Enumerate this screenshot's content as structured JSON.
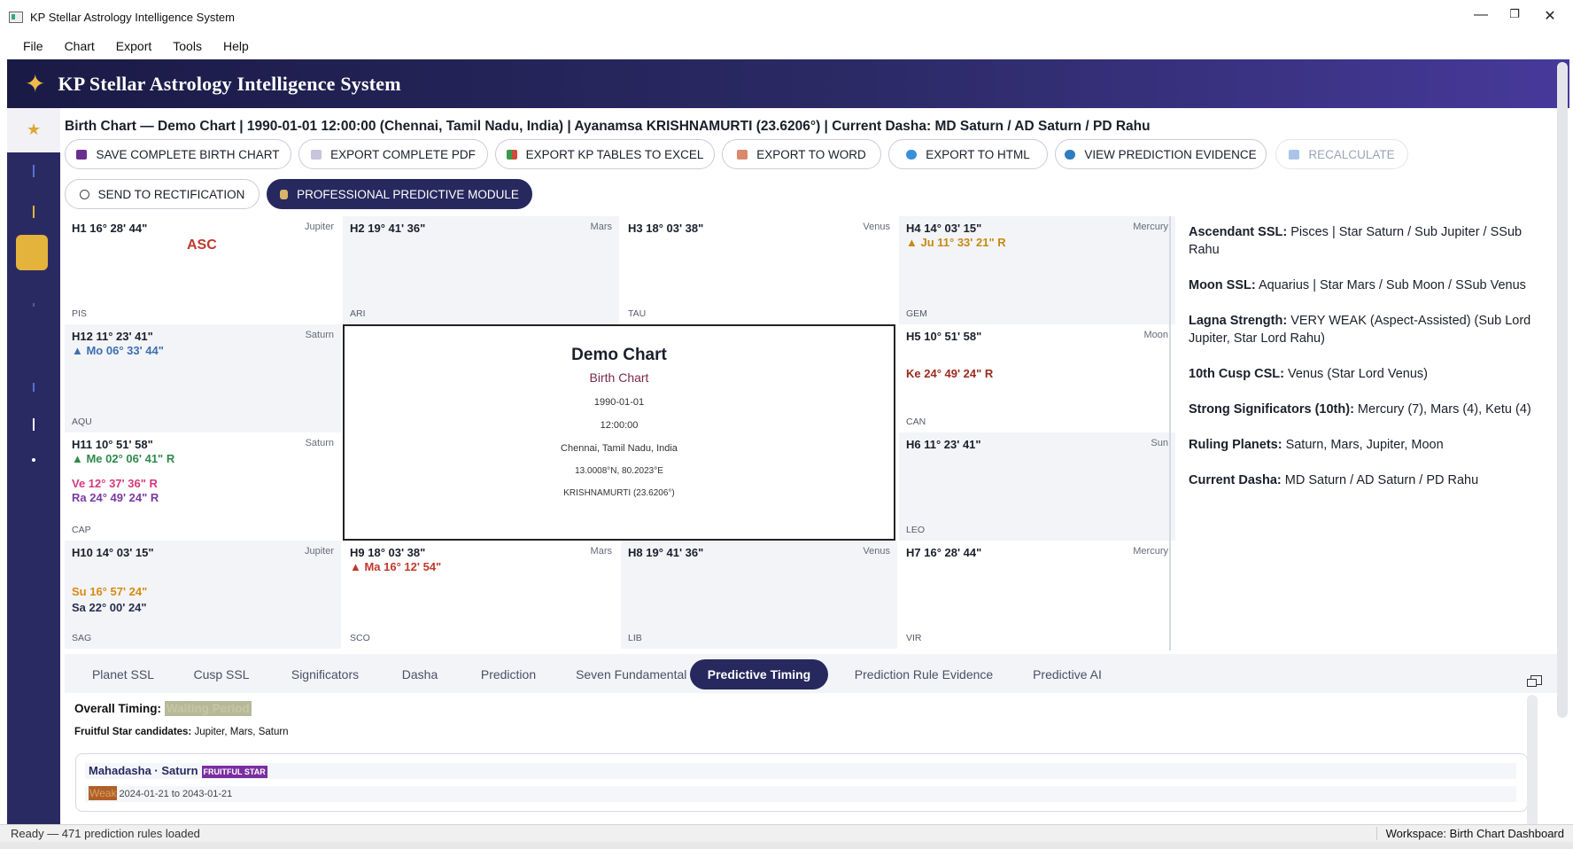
{
  "window": {
    "title": "KP Stellar Astrology Intelligence System",
    "min": "—",
    "max": "❐",
    "close": "✕"
  },
  "menu": [
    "File",
    "Chart",
    "Export",
    "Tools",
    "Help"
  ],
  "banner": {
    "title": "KP Stellar Astrology Intelligence System"
  },
  "info_line": "Birth Chart — Demo Chart  |  1990-01-01 12:00:00 (Chennai, Tamil Nadu, India)  |  Ayanamsa KRISHNAMURTI (23.6206°)  |  Current Dasha: MD Saturn / AD Saturn / PD Rahu",
  "buttons": {
    "save": "SAVE COMPLETE BIRTH CHART",
    "pdf": "EXPORT COMPLETE PDF",
    "excel": "EXPORT KP TABLES TO EXCEL",
    "word": "EXPORT TO WORD",
    "html": "EXPORT TO HTML",
    "evidence": "VIEW PREDICTION EVIDENCE",
    "recalc": "RECALCULATE",
    "rectify": "SEND TO RECTIFICATION",
    "predictive": "PROFESSIONAL PREDICTIVE MODULE"
  },
  "cells": {
    "h1": {
      "house": "H1  16° 28' 44\"",
      "lord": "Jupiter",
      "sign": "PIS",
      "asc": "ASC"
    },
    "h2": {
      "house": "H2  19° 41' 36\"",
      "lord": "Mars",
      "sign": "ARI"
    },
    "h3": {
      "house": "H3  18° 03' 38\"",
      "lord": "Venus",
      "sign": "TAU"
    },
    "h4": {
      "house": "H4  14° 03' 15\"",
      "lord": "Mercury",
      "sign": "GEM",
      "p1": "▲ Ju 11° 33' 21\" R"
    },
    "h12": {
      "house": "H12  11° 23' 41\"",
      "lord": "Saturn",
      "sign": "AQU",
      "p1": "▲ Mo 06° 33' 44\""
    },
    "h5": {
      "house": "H5  10° 51' 58\"",
      "lord": "Moon",
      "sign": "CAN",
      "p1": "Ke 24° 49' 24\" R"
    },
    "h11": {
      "house": "H11  10° 51' 58\"",
      "lord": "Saturn",
      "sign": "CAP",
      "p1": "▲ Me 02° 06' 41\" R",
      "p2": "Ve 12° 37' 36\" R",
      "p3": "Ra 24° 49' 24\" R"
    },
    "h6": {
      "house": "H6  11° 23' 41\"",
      "lord": "Sun",
      "sign": "LEO"
    },
    "h10": {
      "house": "H10  14° 03' 15\"",
      "lord": "Jupiter",
      "sign": "SAG",
      "p1": "Su 16° 57' 24\"",
      "p2": "Sa 22° 00' 24\""
    },
    "h9": {
      "house": "H9  18° 03' 38\"",
      "lord": "Mars",
      "sign": "SCO",
      "p1": "▲ Ma 16° 12' 54\""
    },
    "h8": {
      "house": "H8  19° 41' 36\"",
      "lord": "Venus",
      "sign": "LIB"
    },
    "h7": {
      "house": "H7  16° 28' 44\"",
      "lord": "Mercury",
      "sign": "VIR"
    }
  },
  "center": {
    "name": "Demo Chart",
    "subtitle": "Birth Chart",
    "date": "1990-01-01",
    "time": "12:00:00",
    "place": "Chennai, Tamil Nadu, India",
    "coords": "13.0008°N, 80.2023°E",
    "ayanamsa": "KRISHNAMURTI (23.6206°)"
  },
  "side": [
    {
      "label": "Ascendant SSL:",
      "value": " Pisces | Star Saturn / Sub Jupiter / SSub Rahu"
    },
    {
      "label": "Moon SSL:",
      "value": " Aquarius | Star Mars / Sub Moon / SSub Venus"
    },
    {
      "label": "Lagna Strength:",
      "value": " VERY WEAK (Aspect-Assisted) (Sub Lord Jupiter, Star Lord Rahu)"
    },
    {
      "label": "10th Cusp CSL:",
      "value": " Venus (Star Lord Venus)"
    },
    {
      "label": "Strong Significators (10th):",
      "value": " Mercury (7), Mars (4), Ketu (4)"
    },
    {
      "label": "Ruling Planets:",
      "value": " Saturn, Mars, Jupiter, Moon"
    },
    {
      "label": "Current Dasha:",
      "value": " MD Saturn / AD Saturn / PD Rahu"
    }
  ],
  "tabs": [
    "Planet SSL",
    "Cusp SSL",
    "Significators",
    "Dasha",
    "Prediction",
    "Seven Fundamental KP",
    "Predictive Timing",
    "Prediction Rule Evidence",
    "Predictive AI"
  ],
  "timing": {
    "overall_label": "Overall Timing:",
    "overall_value": "Waiting Period",
    "fruitful_label": "Fruitful Star candidates:",
    "fruitful_value": " Jupiter, Mars, Saturn",
    "md_label": "Mahadasha · Saturn",
    "md_tag": "FRUITFUL STAR",
    "strength": "Weak",
    "period": "2024-01-21 to 2043-01-21"
  },
  "status": {
    "left": "Ready — 471 prediction rules loaded",
    "right": "Workspace: Birth Chart Dashboard"
  },
  "colors": {
    "accent": "#26285e",
    "asc": "#c0392b",
    "gold": "#e4b33b"
  }
}
